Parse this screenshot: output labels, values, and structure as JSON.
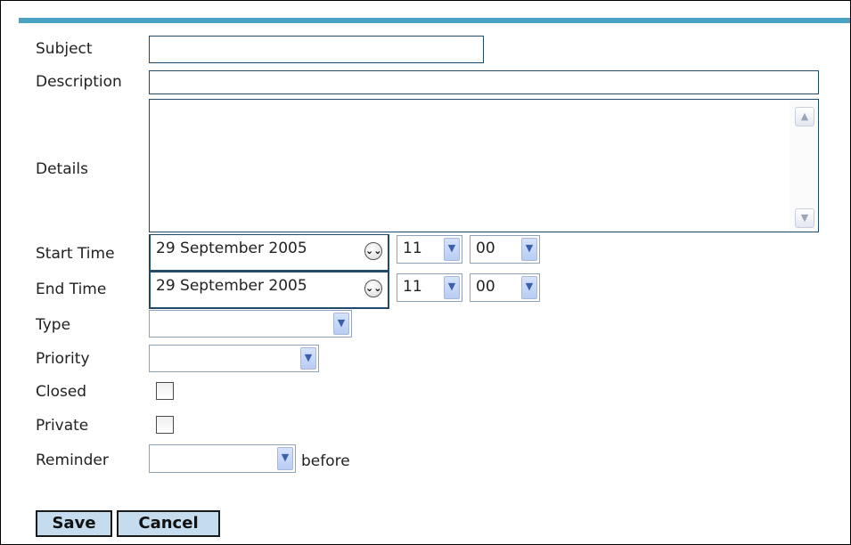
{
  "form": {
    "subject_label": "Subject",
    "subject_value": "",
    "description_label": "Description",
    "description_value": "",
    "details_label": "Details",
    "details_value": "",
    "start_time_label": "Start Time",
    "start_date": "29 September 2005",
    "start_hour": "11",
    "start_minute": "00",
    "end_time_label": "End Time",
    "end_date": "29 September 2005",
    "end_hour": "11",
    "end_minute": "00",
    "type_label": "Type",
    "type_value": "",
    "priority_label": "Priority",
    "priority_value": "",
    "closed_label": "Closed",
    "closed_checked": false,
    "private_label": "Private",
    "private_checked": false,
    "reminder_label": "Reminder",
    "reminder_value": "",
    "reminder_suffix": "before"
  },
  "actions": {
    "save_label": "Save",
    "cancel_label": "Cancel"
  },
  "icons": {
    "calendar": "double-chevron-down-icon",
    "dropdown": "chevron-down-icon",
    "scroll_up": "triangle-up-icon",
    "scroll_down": "triangle-down-icon"
  },
  "colors": {
    "accent_bar": "#4aa3c4",
    "field_border": "#1f4a6b",
    "button_bg": "#c4dced"
  }
}
